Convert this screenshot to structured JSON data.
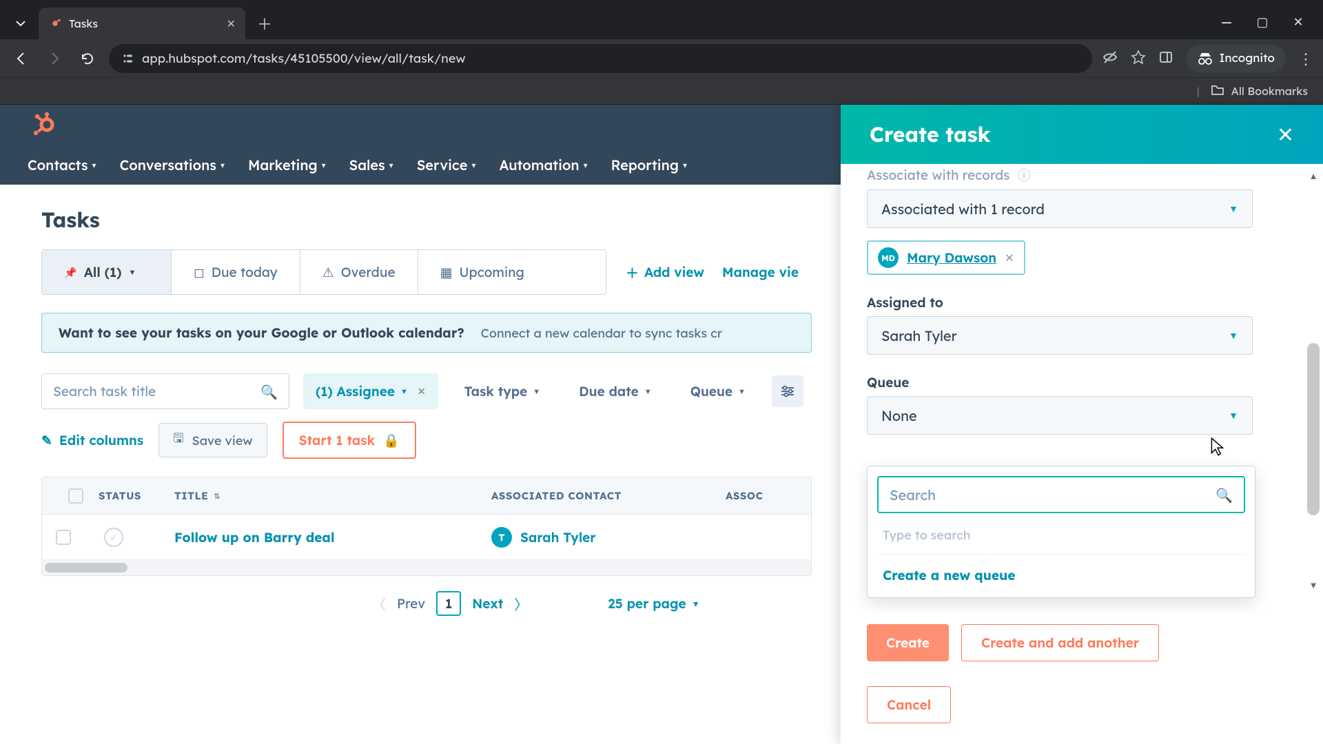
{
  "browser": {
    "tab_title": "Tasks",
    "url": "app.hubspot.com/tasks/45105500/view/all/task/new",
    "incognito_label": "Incognito",
    "bookmarks_label": "All Bookmarks"
  },
  "nav": {
    "items": [
      "Contacts",
      "Conversations",
      "Marketing",
      "Sales",
      "Service",
      "Automation",
      "Reporting"
    ]
  },
  "page": {
    "title": "Tasks",
    "tabs": {
      "all": "All (1)",
      "due_today": "Due today",
      "overdue": "Overdue",
      "upcoming": "Upcoming"
    },
    "add_view": "Add view",
    "manage_views": "Manage vie",
    "banner_bold": "Want to see your tasks on your Google or Outlook calendar?",
    "banner_light": "Connect a new calendar to sync tasks cr",
    "search_placeholder": "Search task title",
    "filters": {
      "assignee": "(1) Assignee",
      "task_type": "Task type",
      "due_date": "Due date",
      "queue": "Queue"
    },
    "edit_columns": "Edit columns",
    "save_view": "Save view",
    "start_task": "Start 1 task",
    "columns": {
      "status": "STATUS",
      "title": "TITLE",
      "assoc_contact": "ASSOCIATED CONTACT",
      "assoc_trunc": "ASSOC"
    },
    "row": {
      "title": "Follow up on Barry deal",
      "contact_initial": "T",
      "contact": "Sarah Tyler"
    },
    "pager": {
      "prev": "Prev",
      "page": "1",
      "next": "Next",
      "per_page": "25 per page"
    }
  },
  "panel": {
    "title": "Create task",
    "assoc_label_trunc": "Associate with records",
    "assoc_value": "Associated with 1 record",
    "record_initials": "MD",
    "record_name": "Mary Dawson",
    "assigned_label": "Assigned to",
    "assigned_value": "Sarah Tyler",
    "queue_label": "Queue",
    "queue_value": "None",
    "dd_search_placeholder": "Search",
    "dd_hint": "Type to search",
    "dd_create": "Create a new queue",
    "btn_create": "Create",
    "btn_create_another": "Create and add another",
    "btn_cancel": "Cancel"
  }
}
